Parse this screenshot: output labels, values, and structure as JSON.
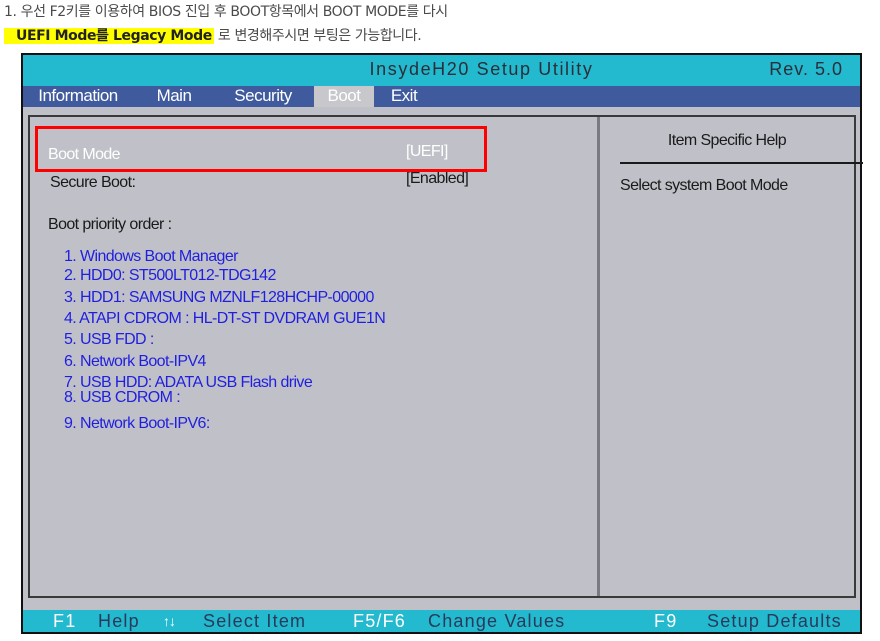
{
  "caption": {
    "line1": "1. 우선 F2키를 이용하여 BIOS 진입 후 BOOT항목에서 BOOT MODE를 다시",
    "line2_highlight": "UEFI Mode를 Legacy Mode",
    "line2_rest": " 로 변경해주시면 부팅은 가능합니다.",
    "highlight_color": "#ffff00"
  },
  "bios": {
    "title": "InsydeH20 Setup Utility",
    "revision": "Rev. 5.0",
    "colors": {
      "title_bar": "#23b9cf",
      "menu_bar": "#3f5b9e",
      "panel": "#c0c0c8",
      "priority_text": "#1f1fe0",
      "annotation_box": "#ff0000"
    },
    "menu": [
      {
        "label": "Information",
        "active": false
      },
      {
        "label": "Main",
        "active": false
      },
      {
        "label": "Security",
        "active": false
      },
      {
        "label": "Boot",
        "active": true
      },
      {
        "label": "Exit",
        "active": false
      }
    ],
    "settings": [
      {
        "label": "Boot Mode",
        "value": "[UEFI]",
        "selected": true
      },
      {
        "label": "Secure Boot:",
        "value": "[Enabled]",
        "selected": false
      }
    ],
    "priority_title": "Boot priority order :",
    "priority": [
      "1. Windows Boot Manager",
      "2. HDD0: ST500LT012-TDG142",
      "3. HDD1: SAMSUNG MZNLF128HCHP-00000",
      "4. ATAPI CDROM : HL-DT-ST DVDRAM GUE1N",
      "5. USB FDD :",
      "6. Network Boot-IPV4",
      "7. USB HDD: ADATA USB Flash drive",
      "8. USB CDROM :",
      "9. Network Boot-IPV6:"
    ],
    "help": {
      "title": "Item Specific Help",
      "text": "Select system Boot Mode"
    },
    "footer": [
      {
        "key": "F1",
        "desc": "Help",
        "icon": "up-down-arrows-icon"
      },
      {
        "key": "↑↓",
        "desc": "Select  Item"
      },
      {
        "key": "F5/F6",
        "desc": "Change  Values"
      },
      {
        "key": "F9",
        "desc": "Setup  Defaults"
      }
    ]
  }
}
